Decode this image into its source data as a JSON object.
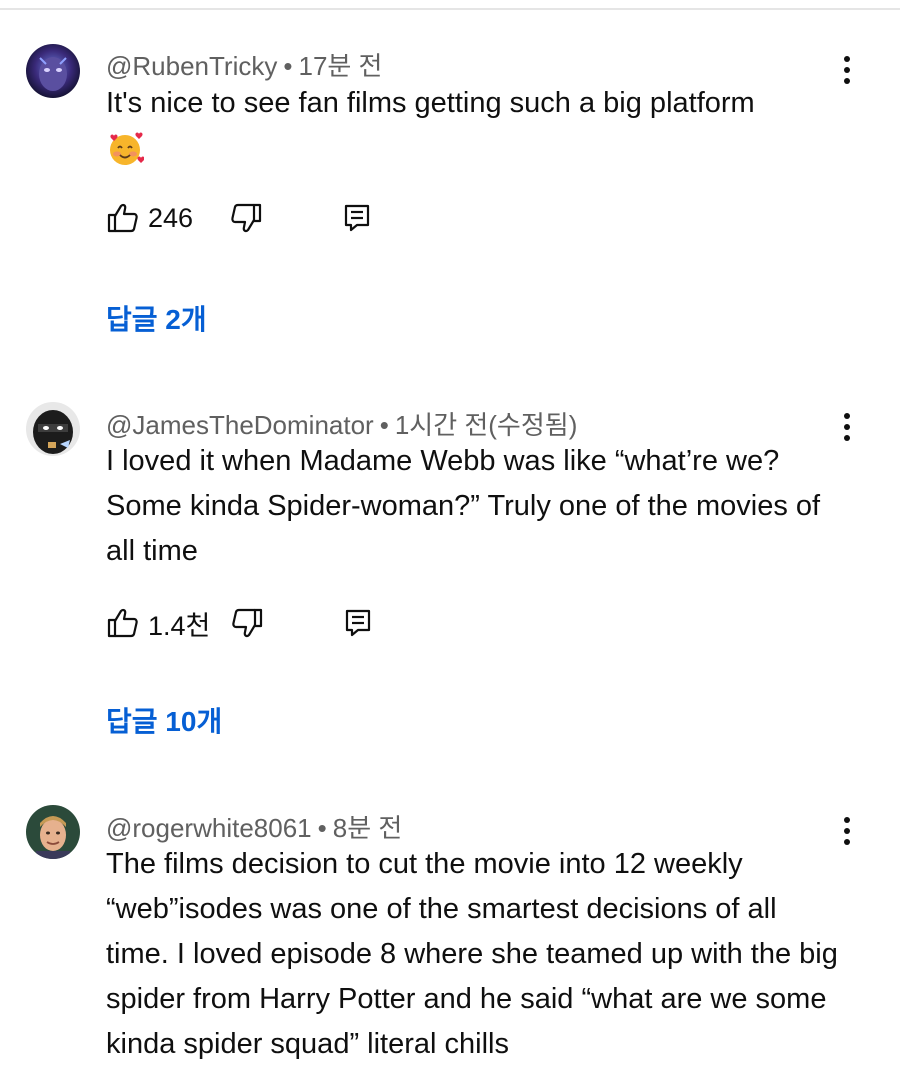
{
  "comments": [
    {
      "handle": "@RubenTricky",
      "time": "17분 전",
      "text": "It's nice to see fan films getting such a big platform",
      "emoji_name": "smiling-face-with-hearts",
      "likes": "246",
      "replies_label": "답글 2개"
    },
    {
      "handle": "@JamesTheDominator",
      "time": "1시간 전(수정됨)",
      "text": "I loved it when Madame Webb was like “what’re we? Some kinda Spider-woman?” Truly one of the movies of all time",
      "likes": "1.4천",
      "replies_label": "답글 10개"
    },
    {
      "handle": "@rogerwhite8061",
      "time": "8분 전",
      "text": "The films decision to cut the movie into 12 weekly “web”isodes was one of the smartest decisions of all time. I loved episode 8 where she teamed up with the big spider from Harry Potter and he said “what are we some kinda spider squad” literal chills"
    }
  ],
  "meta_separator": "•",
  "icons": [
    "like-icon",
    "dislike-icon",
    "reply-icon",
    "more-options-icon"
  ],
  "colors": {
    "link_blue": "#065fd4",
    "meta_gray": "#606060",
    "text": "#0f0f0f"
  }
}
